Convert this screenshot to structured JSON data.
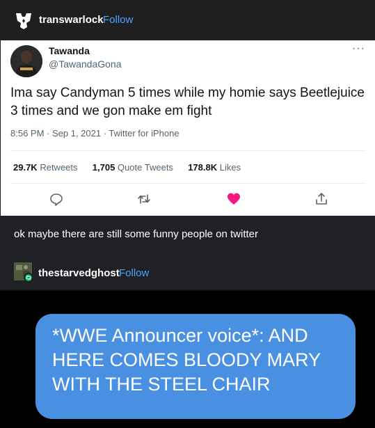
{
  "post": {
    "username": "transwarlock",
    "follow_label": "Follow"
  },
  "tweet": {
    "name": "Tawanda",
    "handle": "@TawandaGona",
    "more_label": "···",
    "text": "Ima say Candyman 5 times while my homie says Beetlejuice 3 times and we gon make em fight",
    "meta": "8:56 PM · Sep 1, 2021 · Twitter for iPhone",
    "stats": {
      "retweets_count": "29.7K",
      "retweets_label": "Retweets",
      "quotes_count": "1,705",
      "quotes_label": "Quote Tweets",
      "likes_count": "178.8K",
      "likes_label": "Likes"
    }
  },
  "caption": "ok maybe there are still some funny people on twitter",
  "reblog": {
    "username": "thestarvedghost",
    "follow_label": "Follow"
  },
  "message": {
    "text": "*WWE Announcer voice*: AND HERE COMES BLOODY MARY WITH THE STEEL CHAIR"
  },
  "colors": {
    "follow": "#4aa3ff",
    "like": "#f91880",
    "bubble": "#4a90e2"
  }
}
